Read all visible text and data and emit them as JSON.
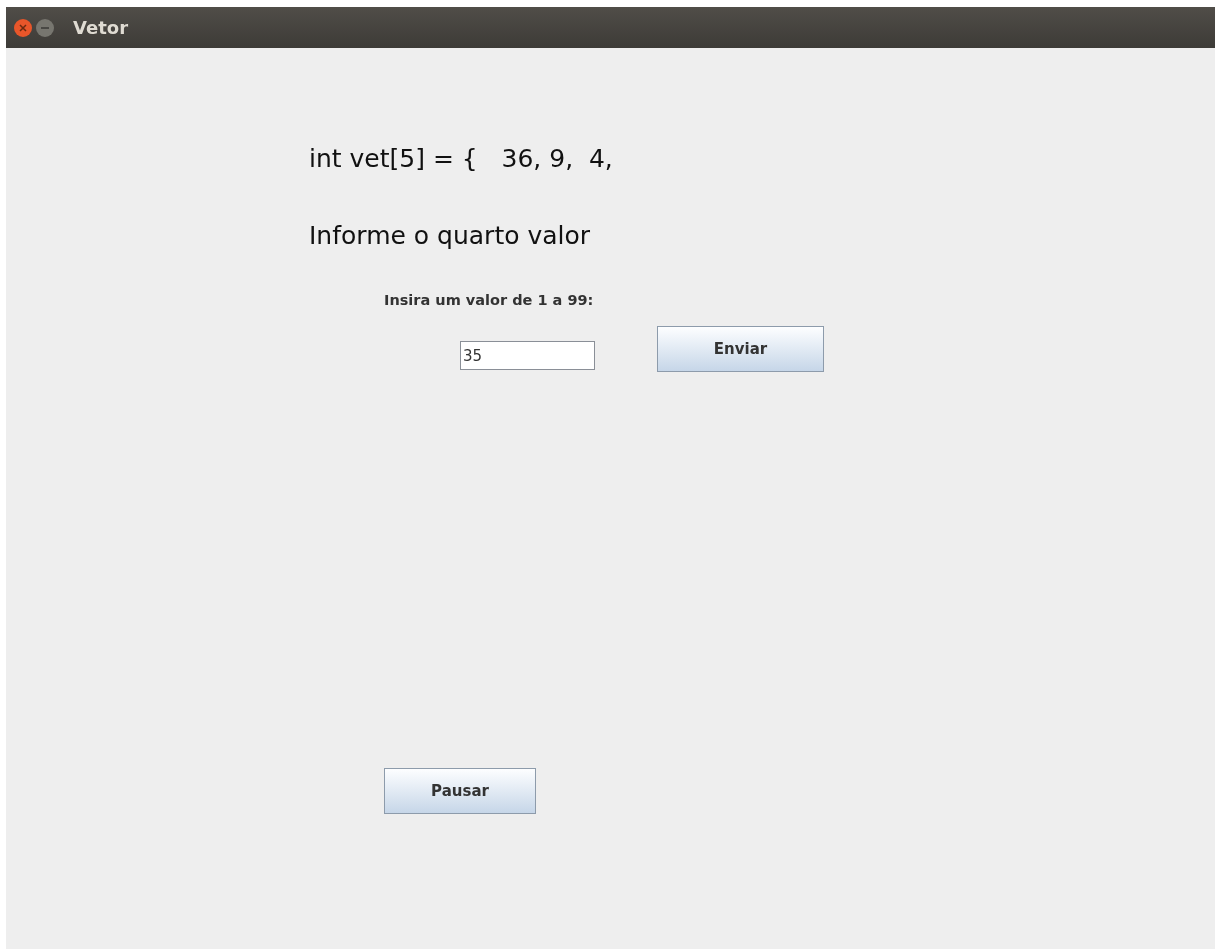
{
  "window": {
    "title": "Vetor"
  },
  "vector_line": "int vet[5] = {   36, 9,  4,",
  "prompt": "Informe o quarto valor",
  "input_label": "Insira um valor de 1 a 99:",
  "input": {
    "value": "35"
  },
  "buttons": [
    {
      "label": "Enviar",
      "kind": "submit"
    },
    {
      "label": "Pausar",
      "kind": "pause"
    }
  ]
}
